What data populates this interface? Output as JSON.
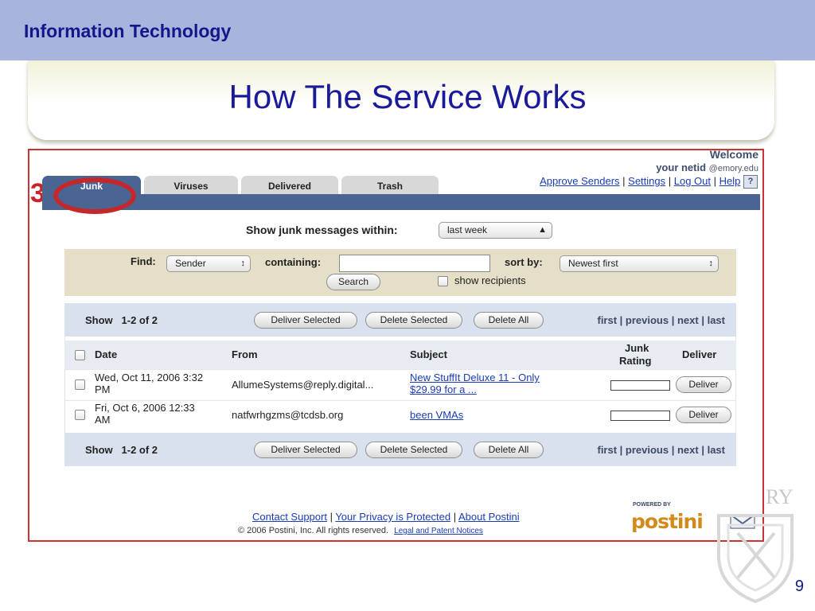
{
  "slide": {
    "organization": "Information Technology",
    "title": "How The Service Works",
    "page_number": "9",
    "step_number": "3",
    "seal_text": "RY"
  },
  "tabs": [
    {
      "label": "Junk",
      "active": true
    },
    {
      "label": "Viruses",
      "active": false
    },
    {
      "label": "Delivered",
      "active": false
    },
    {
      "label": "Trash",
      "active": false
    }
  ],
  "welcome": {
    "line1": "Welcome",
    "user": "your netid",
    "domain": "@emory.edu"
  },
  "top_links": {
    "approve_senders": "Approve Senders",
    "settings": "Settings",
    "log_out": "Log Out",
    "help": "Help",
    "help_icon": "?"
  },
  "filter": {
    "label": "Show junk messages within:",
    "period": "last week"
  },
  "find": {
    "label": "Find:",
    "field": "Sender",
    "containing_label": "containing:",
    "containing_value": "",
    "sort_label": "sort by:",
    "sort_value": "Newest first",
    "search_button": "Search",
    "show_recipients": "show recipients"
  },
  "list": {
    "show_label": "Show",
    "range": "1-2 of 2",
    "deliver_selected": "Deliver Selected",
    "delete_selected": "Delete Selected",
    "delete_all": "Delete All",
    "pager": {
      "first": "first",
      "previous": "previous",
      "next": "next",
      "last": "last"
    },
    "columns": {
      "date": "Date",
      "from": "From",
      "subject": "Subject",
      "junk_rating_1": "Junk",
      "junk_rating_2": "Rating",
      "deliver": "Deliver"
    },
    "rows": [
      {
        "date_1": "Wed, Oct 11, 2006 3:32",
        "date_2": "PM",
        "from": "AllumeSystems@reply.digital...",
        "subject_1": "New StuffIt Deluxe 11 - Only",
        "subject_2": "$29.99 for a ...",
        "deliver": "Deliver"
      },
      {
        "date_1": "Fri, Oct 6, 2006 12:33",
        "date_2": "AM",
        "from": "natfwrhgzms@tcdsb.org",
        "subject_1": "been VMAs",
        "subject_2": "",
        "deliver": "Deliver"
      }
    ]
  },
  "footer": {
    "contact_support": "Contact Support",
    "privacy": "Your Privacy is Protected",
    "about": "About Postini",
    "copyright": "© 2006 Postini, Inc. All rights reserved.",
    "legal": "Legal and Patent Notices",
    "powered_by": "POWERED BY",
    "logo": "postini"
  },
  "colors": {
    "header_bar": "#a6b4de",
    "title_text": "#1a1a9a",
    "tab_active": "#4b6592",
    "frame_border": "#cc3333",
    "highlight_circle": "#c4282a",
    "link": "#1a3cb6"
  }
}
